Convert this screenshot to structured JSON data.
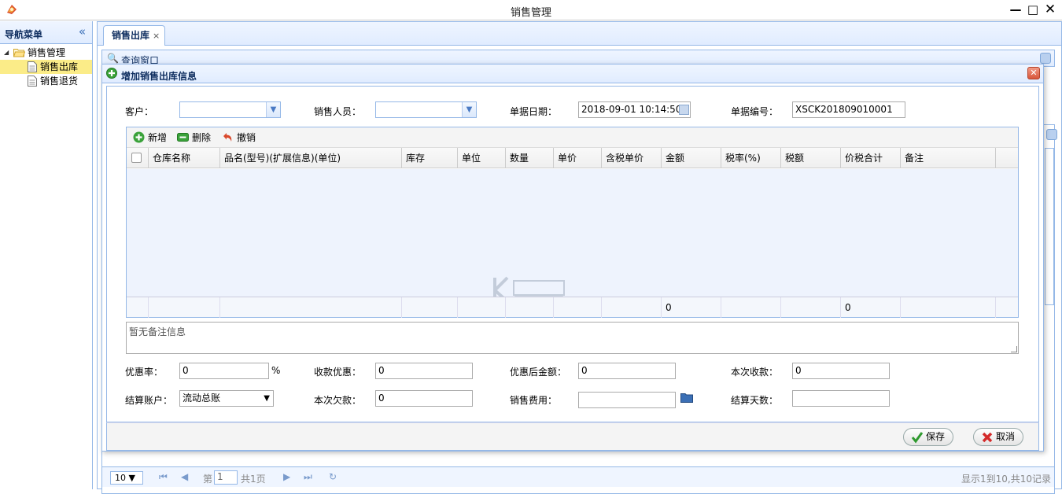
{
  "window": {
    "title": "销售管理",
    "min": "—",
    "max": "□",
    "close": "✕"
  },
  "sidebar": {
    "title": "导航菜单",
    "collapse": "«",
    "root": {
      "arrow": "◢",
      "label": "销售管理"
    },
    "items": [
      {
        "label": "销售出库",
        "selected": true
      },
      {
        "label": "销售退货",
        "selected": false
      }
    ]
  },
  "tabs": [
    {
      "label": "销售出库",
      "close": "×"
    }
  ],
  "query_panel": {
    "title": "查询窗口"
  },
  "pager": {
    "page_size": "10 ▼",
    "page_prefix": "第",
    "page_value": "1",
    "page_suffix": "共1页",
    "summary": "显示1到10,共10记录"
  },
  "dialog": {
    "title": "增加销售出库信息",
    "close": "✕",
    "fields": {
      "customer": {
        "label": "客户：",
        "value": ""
      },
      "salesperson": {
        "label": "销售人员：",
        "value": ""
      },
      "date": {
        "label": "单据日期：",
        "value": "2018-09-01 10:14:50"
      },
      "doc_no": {
        "label": "单据编号：",
        "value": "XSCK201809010001"
      },
      "discount_rate": {
        "label": "优惠率：",
        "value": "0",
        "unit": "%"
      },
      "receipt_discount": {
        "label": "收款优惠：",
        "value": "0"
      },
      "amount_after": {
        "label": "优惠后金额：",
        "value": "0"
      },
      "this_receipt": {
        "label": "本次收款：",
        "value": "0"
      },
      "account": {
        "label": "结算账户：",
        "value": "流动总账"
      },
      "this_owed": {
        "label": "本次欠款：",
        "value": "0"
      },
      "sales_fee": {
        "label": "销售费用：",
        "value": ""
      },
      "settle_days": {
        "label": "结算天数：",
        "value": ""
      }
    },
    "toolbar": {
      "add": "新增",
      "delete": "删除",
      "undo": "撤销"
    },
    "columns": [
      "仓库名称",
      "品名(型号)(扩展信息)(单位)",
      "库存",
      "单位",
      "数量",
      "单价",
      "含税单价",
      "金额",
      "税率(%)",
      "税额",
      "价税合计",
      "备注"
    ],
    "footer_totals": {
      "amount": "0",
      "total": "0"
    },
    "remark_placeholder": "暂无备注信息",
    "buttons": {
      "save": "保存",
      "cancel": "取消"
    }
  },
  "colors": {
    "border": "#95b8e7",
    "header_bg": "#e0ecff",
    "title_text": "#0e2d5f",
    "selected": "#fbec88",
    "empty_grid": "#eef3fd"
  }
}
